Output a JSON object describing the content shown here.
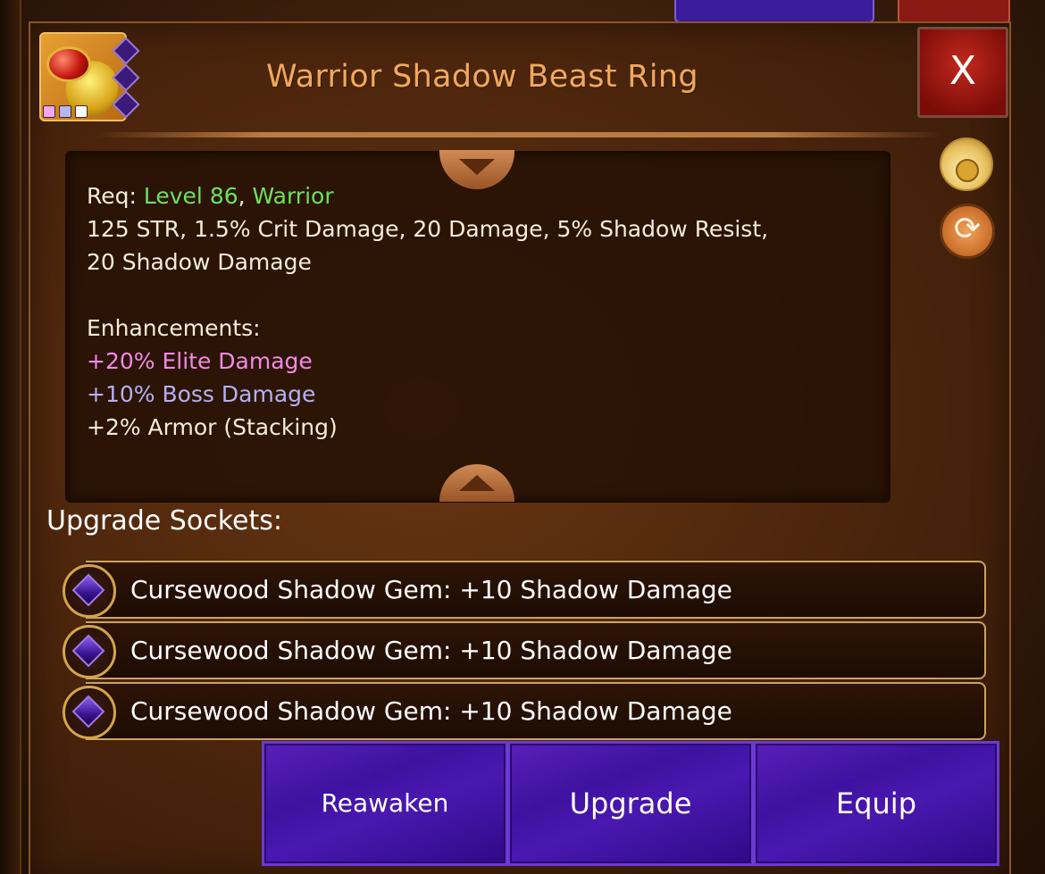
{
  "item": {
    "name": "Warrior Shadow Beast Ring",
    "rarity_dot_colors": [
      "#f2a6f0",
      "#b8b4f0",
      "#ffffff"
    ]
  },
  "close_button": {
    "label": "X"
  },
  "description": {
    "req_label": "Req: ",
    "req_level": "Level 86",
    "req_sep": ", ",
    "req_class": "Warrior",
    "stats_line1": "125 STR, 1.5% Crit Damage, 20 Damage, 5% Shadow Resist,",
    "stats_line2": "20 Shadow Damage",
    "enhancements_heading": "Enhancements:",
    "enhancements": [
      {
        "text": "+20% Elite Damage",
        "color": "#f08ae6"
      },
      {
        "text": "+10% Boss Damage",
        "color": "#b4b0f4"
      },
      {
        "text": "+2% Armor (Stacking)",
        "color": "#f4ecdc"
      }
    ]
  },
  "side_icons": [
    "gold-bag-icon",
    "refresh-icon"
  ],
  "sockets": {
    "heading": "Upgrade Sockets:",
    "items": [
      {
        "label": "Cursewood Shadow Gem: +10 Shadow Damage"
      },
      {
        "label": "Cursewood Shadow Gem: +10 Shadow Damage"
      },
      {
        "label": "Cursewood Shadow Gem: +10 Shadow Damage"
      }
    ]
  },
  "actions": {
    "reawaken": "Reawaken",
    "upgrade": "Upgrade",
    "equip": "Equip"
  }
}
